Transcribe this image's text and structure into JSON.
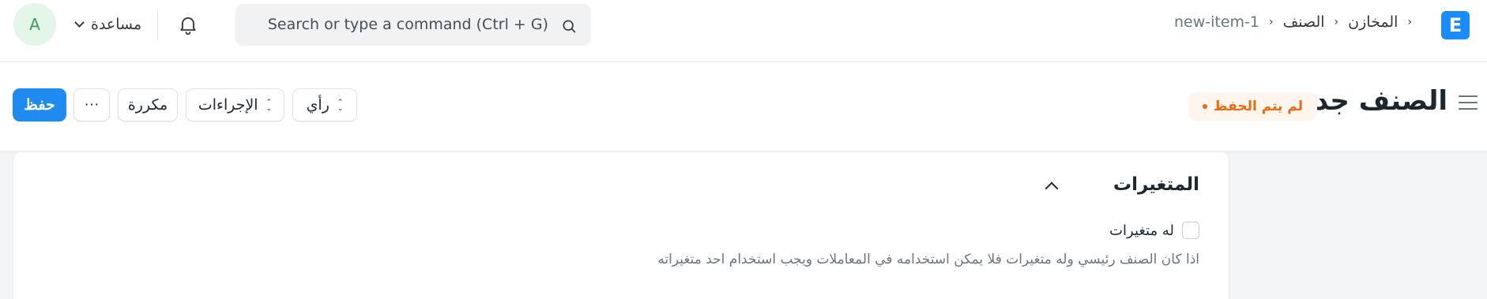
{
  "navbar": {
    "avatar_initial": "A",
    "help_label": "مساعدة",
    "search_placeholder": "Search or type a command (Ctrl + G)",
    "logo_letter": "E",
    "breadcrumb": [
      "المخازن",
      "الصنف",
      "new-item-1"
    ]
  },
  "page": {
    "title": "الصنف جديد",
    "status_badge": "لم يتم الحفظ",
    "buttons": {
      "save": "حفظ",
      "more": "···",
      "duplicate": "مكررة",
      "actions": "الإجراءات",
      "view": "رأي"
    }
  },
  "section": {
    "title": "المتغيرات",
    "checkbox_label": "له متغيرات",
    "checkbox_checked": false,
    "description": "اذا كان الصنف رئيسي وله متغيرات فلا يمكن استخدامه في المعاملات ويجب استخدام احد متغيراته"
  },
  "colors": {
    "primary": "#1f8bf0",
    "logo": "#1a8cff",
    "warning": "#e86c13",
    "avatar_bg": "#e4f5e9",
    "avatar_fg": "#3a9d5d"
  }
}
